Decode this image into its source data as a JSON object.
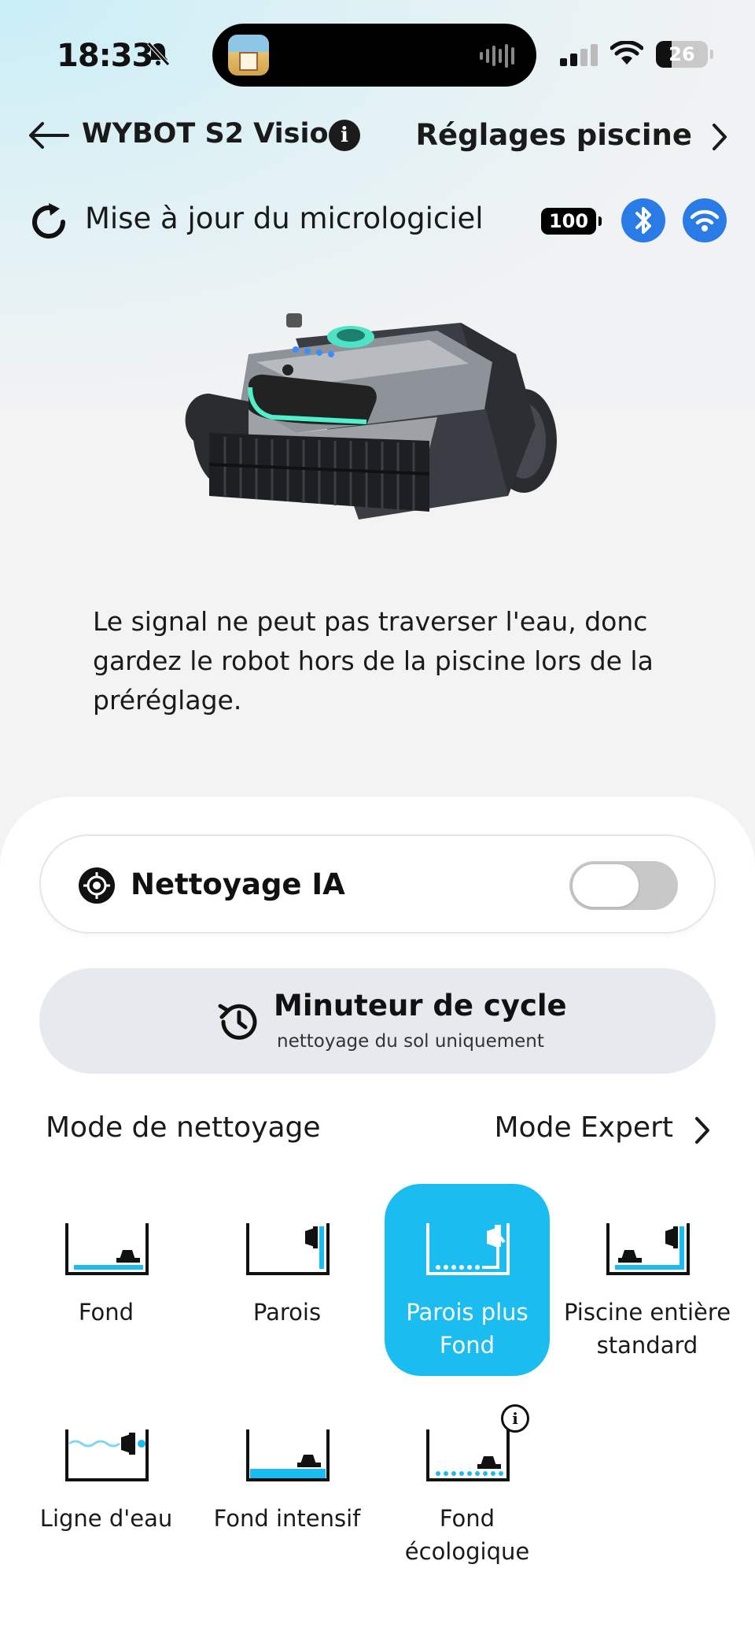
{
  "status_bar": {
    "time": "18:33",
    "battery": "26"
  },
  "header": {
    "device_name": "WYBOT S2 Vision",
    "pool_settings": "Réglages piscine"
  },
  "firmware": {
    "label": "Mise à jour du micrologiciel",
    "robot_battery": "100"
  },
  "notice": "Le signal ne peut pas traverser l'eau, donc gardez le robot hors de la piscine lors de la préréglage.",
  "ai_cleaning": {
    "label": "Nettoyage IA",
    "enabled": false
  },
  "cycle_timer": {
    "title": "Minuteur de cycle",
    "subtitle": "nettoyage du sol uniquement"
  },
  "cleaning": {
    "mode_label": "Mode de nettoyage",
    "expert_label": "Mode Expert",
    "modes": [
      {
        "label": "Fond",
        "icon": "floor-mode-icon",
        "selected": false
      },
      {
        "label": "Parois",
        "icon": "wall-mode-icon",
        "selected": false
      },
      {
        "label": "Parois plus Fond",
        "icon": "wall-floor-mode-icon",
        "selected": true
      },
      {
        "label": "Piscine entière standard",
        "icon": "full-pool-mode-icon",
        "selected": false
      },
      {
        "label": "Ligne d'eau",
        "icon": "waterline-mode-icon",
        "selected": false
      },
      {
        "label": "Fond intensif",
        "icon": "intensive-floor-mode-icon",
        "selected": false
      },
      {
        "label": "Fond écologique",
        "icon": "eco-floor-mode-icon",
        "selected": false
      }
    ]
  },
  "colors": {
    "accent": "#1bbcf0",
    "bluetooth": "#2b7be7"
  }
}
